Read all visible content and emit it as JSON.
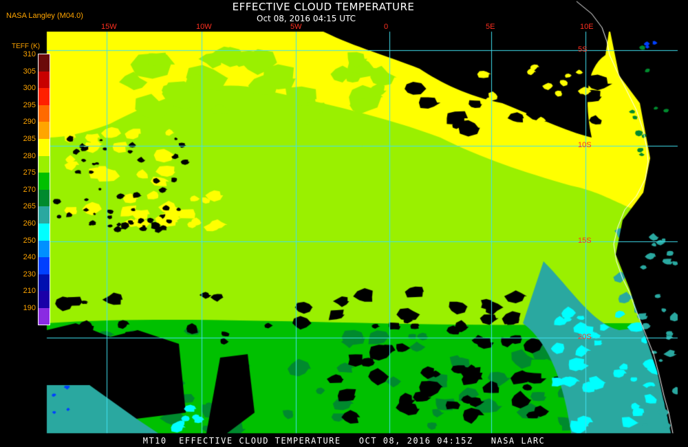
{
  "header": {
    "credit": "NASA Langley (M04.0)",
    "title": "EFFECTIVE CLOUD TEMPERATURE",
    "subtitle": "Oct 08, 2016 04:15 UTC"
  },
  "footer": {
    "text": "MT10  EFFECTIVE CLOUD TEMPERATURE   OCT 08, 2016 04:15Z   NASA LARC"
  },
  "colorbar": {
    "label": "TEFF (K)",
    "ticks": [
      "310",
      "305",
      "300",
      "295",
      "290",
      "285",
      "280",
      "275",
      "270",
      "265",
      "260",
      "250",
      "240",
      "230",
      "210",
      "190"
    ],
    "colors": [
      "#6b0a0a",
      "#c80000",
      "#ff2000",
      "#ff6a00",
      "#ffa500",
      "#ffff00",
      "#9af000",
      "#00c000",
      "#008a2e",
      "#2aa8a0",
      "#00ffff",
      "#0090ff",
      "#0040ff",
      "#0010b0",
      "#1a00a8",
      "#8a2be2"
    ]
  },
  "map": {
    "longitude_labels": [
      "15W",
      "10W",
      "5W",
      "0",
      "5E",
      "10E"
    ],
    "latitude_labels": [
      "5S",
      "10S",
      "15S",
      "20S"
    ],
    "colors": {
      "background": "#000000",
      "grid": "#40e0f0",
      "coast": "#ffffff",
      "yellow": "#ffff00",
      "lime": "#9af000",
      "green": "#00c000",
      "dark_green": "#008a2e",
      "teal": "#2aa8a0",
      "cyan": "#00ffff",
      "blue": "#0040ff"
    }
  }
}
